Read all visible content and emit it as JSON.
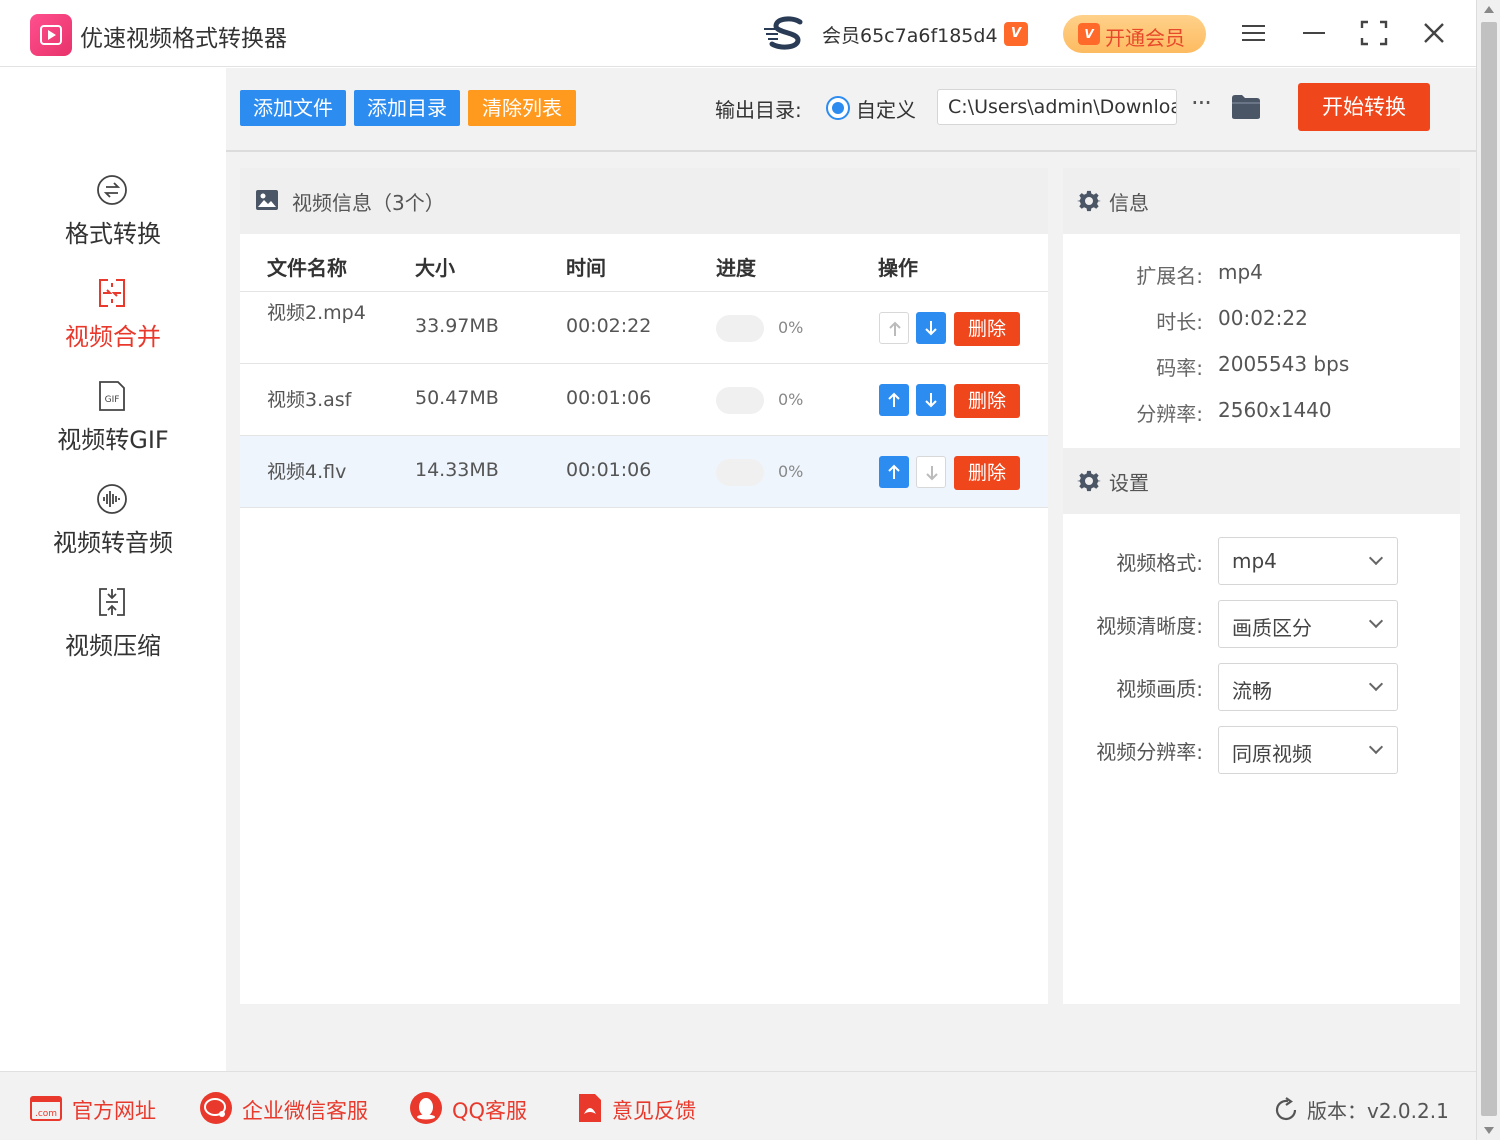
{
  "app": {
    "title": "优速视频格式转换器",
    "member_label": "会员65c7a6f185d4",
    "vip_badge": "V",
    "open_vip_label": "开通会员"
  },
  "sidebar": {
    "items": [
      {
        "label": "格式转换",
        "icon": "convert-icon",
        "active": false
      },
      {
        "label": "视频合并",
        "icon": "merge-icon",
        "active": true
      },
      {
        "label": "视频转GIF",
        "icon": "gif-icon",
        "active": false
      },
      {
        "label": "视频转音频",
        "icon": "audio-icon",
        "active": false
      },
      {
        "label": "视频压缩",
        "icon": "compress-icon",
        "active": false
      }
    ],
    "gif_icon_text": "GIF"
  },
  "toolbar": {
    "add_file": "添加文件",
    "add_folder": "添加目录",
    "clear_list": "清除列表",
    "output_dir_label": "输出目录:",
    "custom_label": "自定义",
    "output_path": "C:\\Users\\admin\\Downloads",
    "more": "···",
    "start": "开始转换"
  },
  "video_panel": {
    "title": "视频信息（3个）",
    "columns": [
      "文件名称",
      "大小",
      "时间",
      "进度",
      "操作"
    ],
    "rows": [
      {
        "name": "视频2.mp4",
        "size": "33.97MB",
        "time": "00:02:22",
        "progress": 0,
        "progress_text": "0%",
        "up_enabled": false,
        "down_enabled": true,
        "delete": "删除"
      },
      {
        "name": "视频3.asf",
        "size": "50.47MB",
        "time": "00:01:06",
        "progress": 0,
        "progress_text": "0%",
        "up_enabled": true,
        "down_enabled": true,
        "delete": "删除"
      },
      {
        "name": "视频4.flv",
        "size": "14.33MB",
        "time": "00:01:06",
        "progress": 0,
        "progress_text": "0%",
        "up_enabled": true,
        "down_enabled": false,
        "delete": "删除"
      }
    ]
  },
  "info": {
    "title": "信息",
    "fields": [
      {
        "label": "扩展名:",
        "value": "mp4"
      },
      {
        "label": "时长:",
        "value": "00:02:22"
      },
      {
        "label": "码率:",
        "value": "2005543 bps"
      },
      {
        "label": "分辨率:",
        "value": "2560x1440"
      }
    ]
  },
  "settings": {
    "title": "设置",
    "fields": [
      {
        "label": "视频格式:",
        "value": "mp4"
      },
      {
        "label": "视频清晰度:",
        "value": "画质区分"
      },
      {
        "label": "视频画质:",
        "value": "流畅"
      },
      {
        "label": "视频分辨率:",
        "value": "同原视频"
      }
    ]
  },
  "footer": {
    "official_site": "官方网址",
    "official_icon_text": ".com",
    "wechat_service": "企业微信客服",
    "qq_service": "QQ客服",
    "feedback": "意见反馈",
    "version": "版本：v2.0.2.1"
  },
  "colors": {
    "accent_blue": "#2d8cf0",
    "accent_red": "#f0461c",
    "accent_orange": "#ff9a1f",
    "active_nav": "#e8392c",
    "vip_gold": "#fdbb60"
  }
}
